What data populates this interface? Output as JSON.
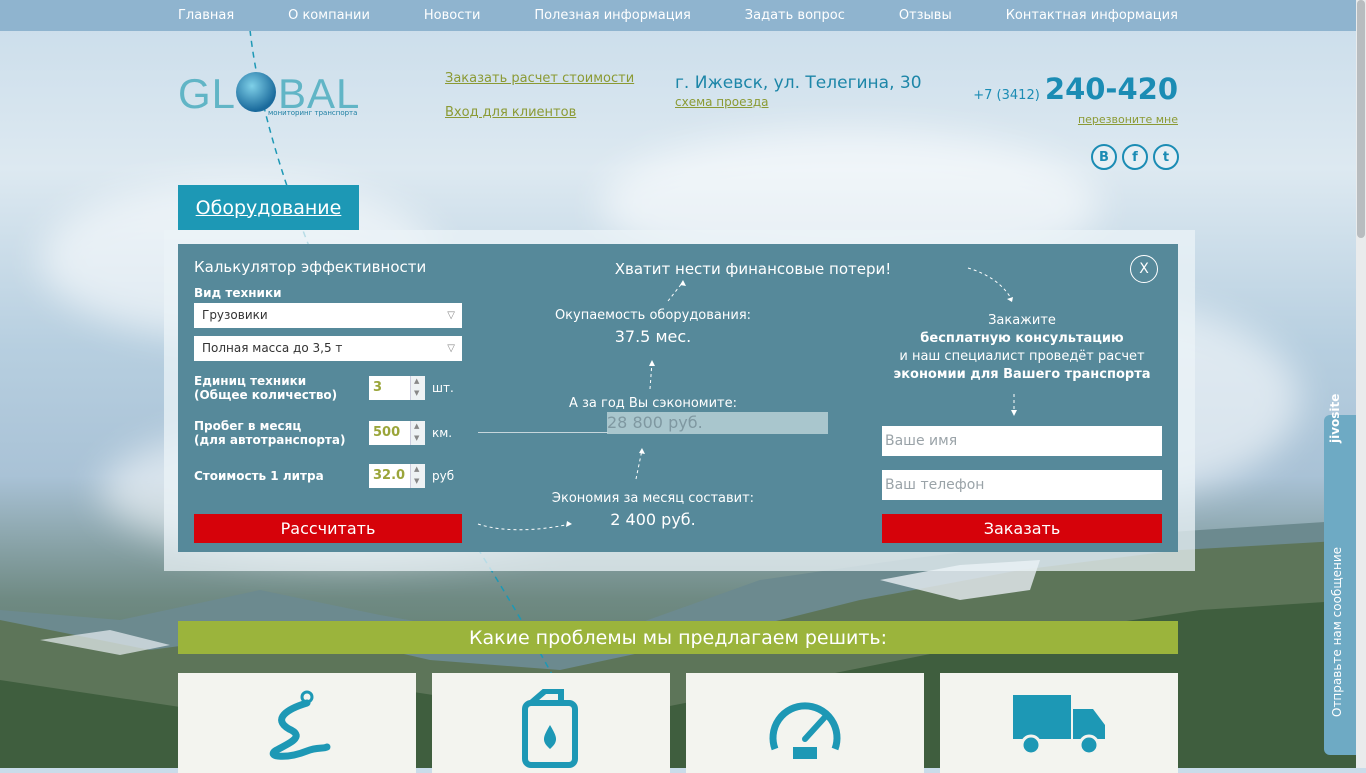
{
  "nav": [
    "Главная",
    "О компании",
    "Новости",
    "Полезная информация",
    "Задать вопрос",
    "Отзывы",
    "Контактная информация"
  ],
  "logo": {
    "text_left": "GL",
    "text_right": "BAL",
    "subtitle": "мониторинг транспорта"
  },
  "header": {
    "order_calc": "Заказать расчет стоимости",
    "client_login": "Вход для клиентов",
    "address": "г. Ижевск, ул. Телегина, 30",
    "route_map": "схема проезда",
    "phone_prefix": "+7 (3412)",
    "phone_number": "240-420",
    "callback": "перезвоните мне",
    "social_icons": [
      "vk-icon",
      "facebook-icon",
      "twitter-icon"
    ]
  },
  "tab": {
    "label": "Оборудование"
  },
  "calculator": {
    "title": "Калькулятор эффективности",
    "vehicle_type_label": "Вид техники",
    "vehicle_type": "Грузовики",
    "mass": "Полная масса до 3,5 т",
    "units_label_1": "Единиц техники",
    "units_label_2": "(Общее количество)",
    "units_value": "3",
    "units_unit": "шт.",
    "mileage_label_1": "Пробег в месяц",
    "mileage_label_2": "(для автотранспорта)",
    "mileage_value": "500",
    "mileage_unit": "км.",
    "cost_label": "Стоимость 1 литра",
    "cost_value": "32.0",
    "cost_unit": "руб",
    "calc_button": "Рассчитать",
    "headline": "Хватит нести финансовые потери!",
    "payback_label": "Окупаемость оборудования:",
    "payback_value": "37.5 мес.",
    "year_label": "А за год Вы сэкономите:",
    "year_value": "28 800 руб.",
    "month_label": "Экономия за месяц составит:",
    "month_value": "2 400 руб.",
    "close": "X",
    "cta_1": "Закажите",
    "cta_2": "бесплатную консультацию",
    "cta_3": "и наш специалист проведёт расчет",
    "cta_4": "экономии для Вашего транспорта",
    "name_placeholder": "Ваше имя",
    "phone_placeholder": "Ваш телефон",
    "order_button": "Заказать"
  },
  "problems": {
    "title": "Какие проблемы мы предлагаем решить:",
    "icons": [
      "route-icon",
      "fuel-canister-icon",
      "speedometer-icon",
      "truck-icon"
    ]
  },
  "colors": {
    "teal": "#1d98b5",
    "panel": "#56899a",
    "red": "#d6020a",
    "green": "#9bb43c"
  },
  "jivo": {
    "brand": "jivosite",
    "message": "Отправьте нам сообщение"
  }
}
